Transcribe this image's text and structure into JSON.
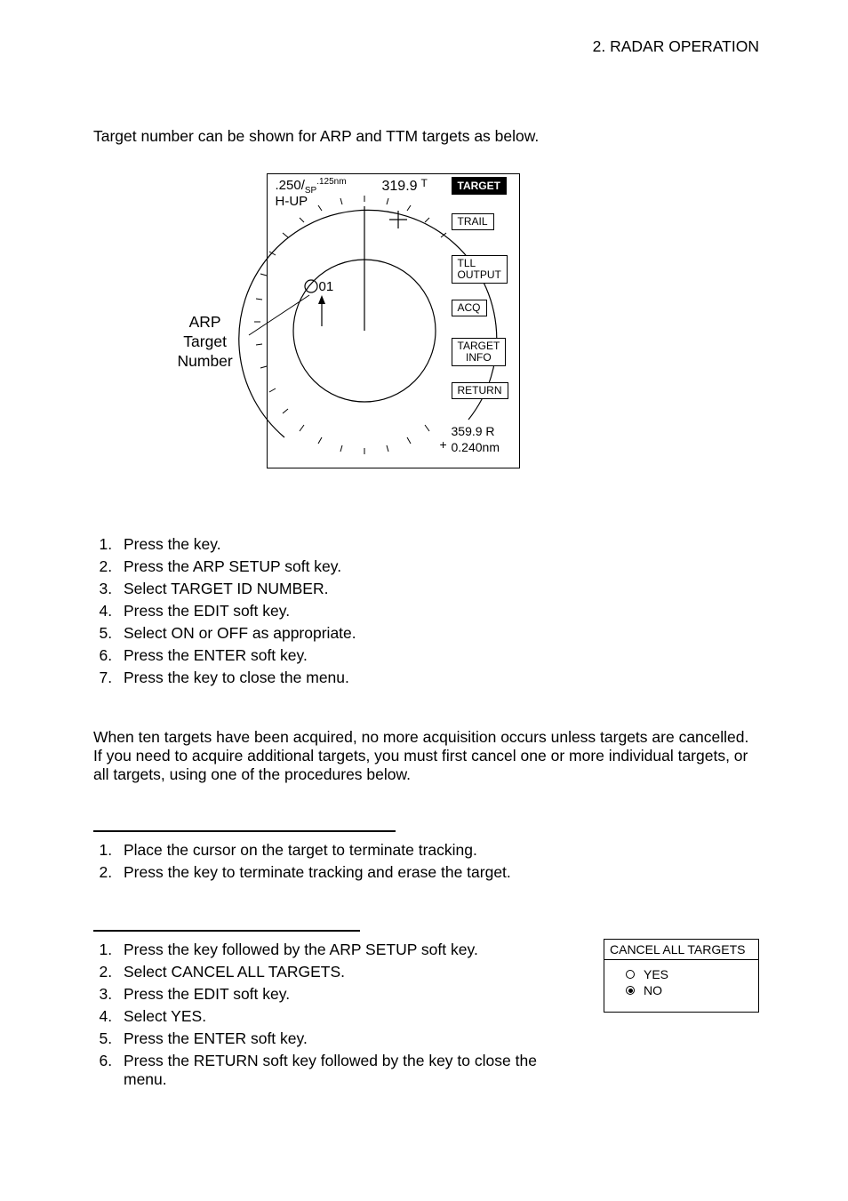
{
  "header": {
    "section_label": "2. RADAR OPERATION"
  },
  "intro": "Target number can be shown for ARP and TTM targets as below.",
  "radar": {
    "range": ".250/",
    "range_sp": "SP",
    "range_nm": ".125nm",
    "mode": "H-UP",
    "bearing": "319.9",
    "bearing_suffix": "T",
    "target_label": "TARGET",
    "softkeys": {
      "trail": "TRAIL",
      "tll": "TLL\nOUTPUT",
      "acq": "ACQ",
      "tinfo": "TARGET\nINFO",
      "return": "RETURN"
    },
    "readout_line1": "359.9 R",
    "readout_line2": "0.240nm",
    "readout_plus": "+",
    "target_id": "01",
    "arp_caption_l1": "ARP",
    "arp_caption_l2": "Target",
    "arp_caption_l3": "Number"
  },
  "steps_a": [
    "Press the            key.",
    "Press the ARP SETUP soft key.",
    "Select TARGET ID NUMBER.",
    "Press the EDIT soft key.",
    "Select ON or OFF as appropriate.",
    "Press the ENTER soft key.",
    "Press the            key to close the menu."
  ],
  "mid_paragraph": "When ten targets have been acquired, no more acquisition occurs unless targets are cancelled. If you need to acquire additional targets, you must first cancel one or more individual targets, or all targets, using one of the procedures below.",
  "steps_b": [
    "Place the cursor on the target to terminate tracking.",
    "Press the               key to terminate tracking and erase the target."
  ],
  "steps_c": [
    "Press the               key followed by the ARP SETUP soft key.",
    "Select CANCEL ALL TARGETS.",
    "Press the EDIT soft key.",
    "Select YES.",
    "Press the ENTER soft key.",
    "Press the RETURN soft key followed by the               key to close the menu."
  ],
  "cancel_box": {
    "title": "CANCEL ALL TARGETS",
    "yes": "YES",
    "no": "NO"
  }
}
